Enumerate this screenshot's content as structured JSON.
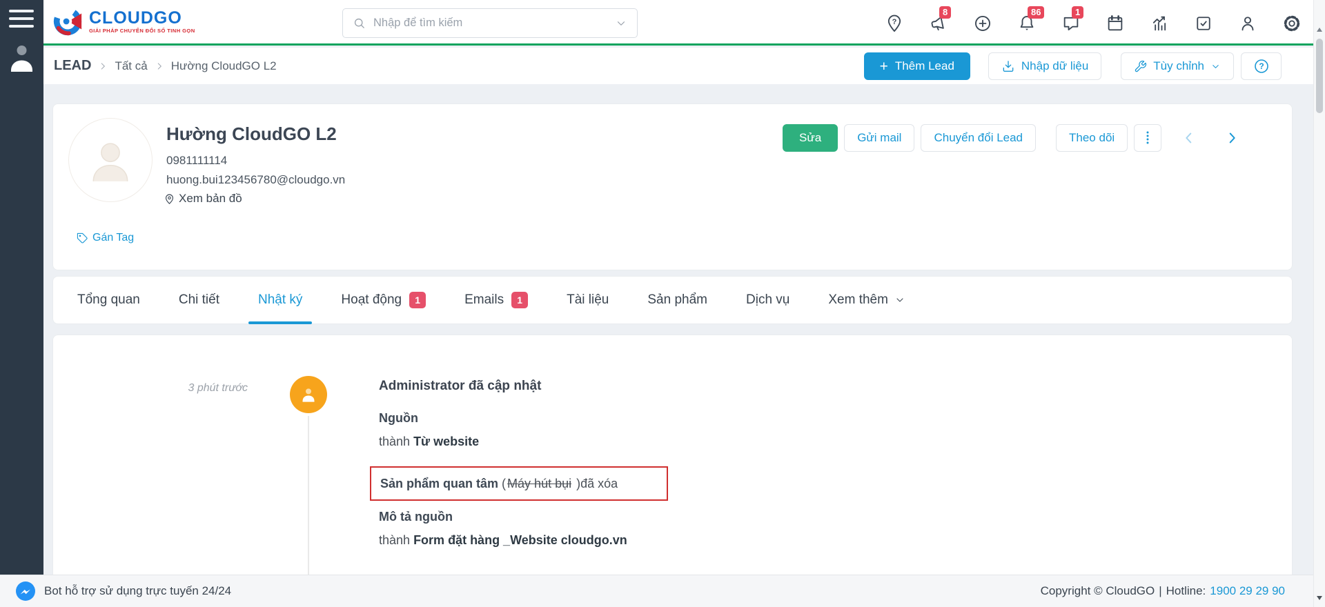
{
  "header": {
    "brand": "CLOUDGO",
    "tagline": "GIẢI PHÁP CHUYỂN ĐỔI SỐ TINH GỌN",
    "search_placeholder": "Nhập để tìm kiếm",
    "icons": [
      "location-pin-help",
      "megaphone",
      "plus-circle",
      "bell",
      "chat",
      "calendar",
      "analytics",
      "tasks",
      "user",
      "settings"
    ],
    "badges": {
      "megaphone": "8",
      "bell": "86",
      "chat": "1"
    }
  },
  "breadcrumb": {
    "root": "LEAD",
    "level1": "Tất cả",
    "level2": "Hường CloudGO L2"
  },
  "toolbar": {
    "add_plus": "+",
    "add_lead": "Thêm Lead",
    "import_data": "Nhập dữ liệu",
    "customize": "Tùy chỉnh",
    "help": "?"
  },
  "lead": {
    "name": "Hường CloudGO L2",
    "phone": "0981111114",
    "email": "huong.bui123456780@cloudgo.vn",
    "map_link": "Xem bản đồ",
    "tag_link": "Gán Tag",
    "edit": "Sửa",
    "send_mail": "Gửi mail",
    "convert": "Chuyển đổi Lead",
    "follow": "Theo dõi"
  },
  "tabs": [
    {
      "label": "Tổng quan"
    },
    {
      "label": "Chi tiết"
    },
    {
      "label": "Nhật ký",
      "active": true
    },
    {
      "label": "Hoạt động",
      "badge": "1"
    },
    {
      "label": "Emails",
      "badge": "1"
    },
    {
      "label": "Tài liệu"
    },
    {
      "label": "Sản phẩm"
    },
    {
      "label": "Dịch vụ"
    },
    {
      "label": "Xem thêm",
      "dropdown": true
    }
  ],
  "timeline": {
    "time": "3 phút trước",
    "title": "Administrator đã cập nhật",
    "change1": {
      "field": "Nguồn",
      "prefix": "thành",
      "value": "Từ website"
    },
    "deleted": {
      "field": "Sản phẩm quan tâm",
      "open": "(",
      "removed": "Máy hút bụi",
      "close": ") ",
      "suffix": "đã xóa"
    },
    "change2": {
      "field": "Mô tả nguồn",
      "prefix": "thành",
      "value": "Form đặt hàng _Website cloudgo.vn"
    }
  },
  "footer": {
    "support": "Bot hỗ trợ sử dụng trực tuyến 24/24",
    "copyright": "Copyright © CloudGO",
    "separator": "|",
    "hotline_label": "Hotline:",
    "hotline_number": "1900 29 29 90"
  },
  "colors": {
    "primary_blue": "#1a98d5",
    "green_button": "#2eb07e",
    "header_line_green": "#0ca35d",
    "badge_red": "#e8475b",
    "tab_badge_red": "#e6506a",
    "timeline_orange": "#f7a41c",
    "highlight_border_red": "#d02f2f",
    "sidebar_dark": "#2c3947"
  }
}
